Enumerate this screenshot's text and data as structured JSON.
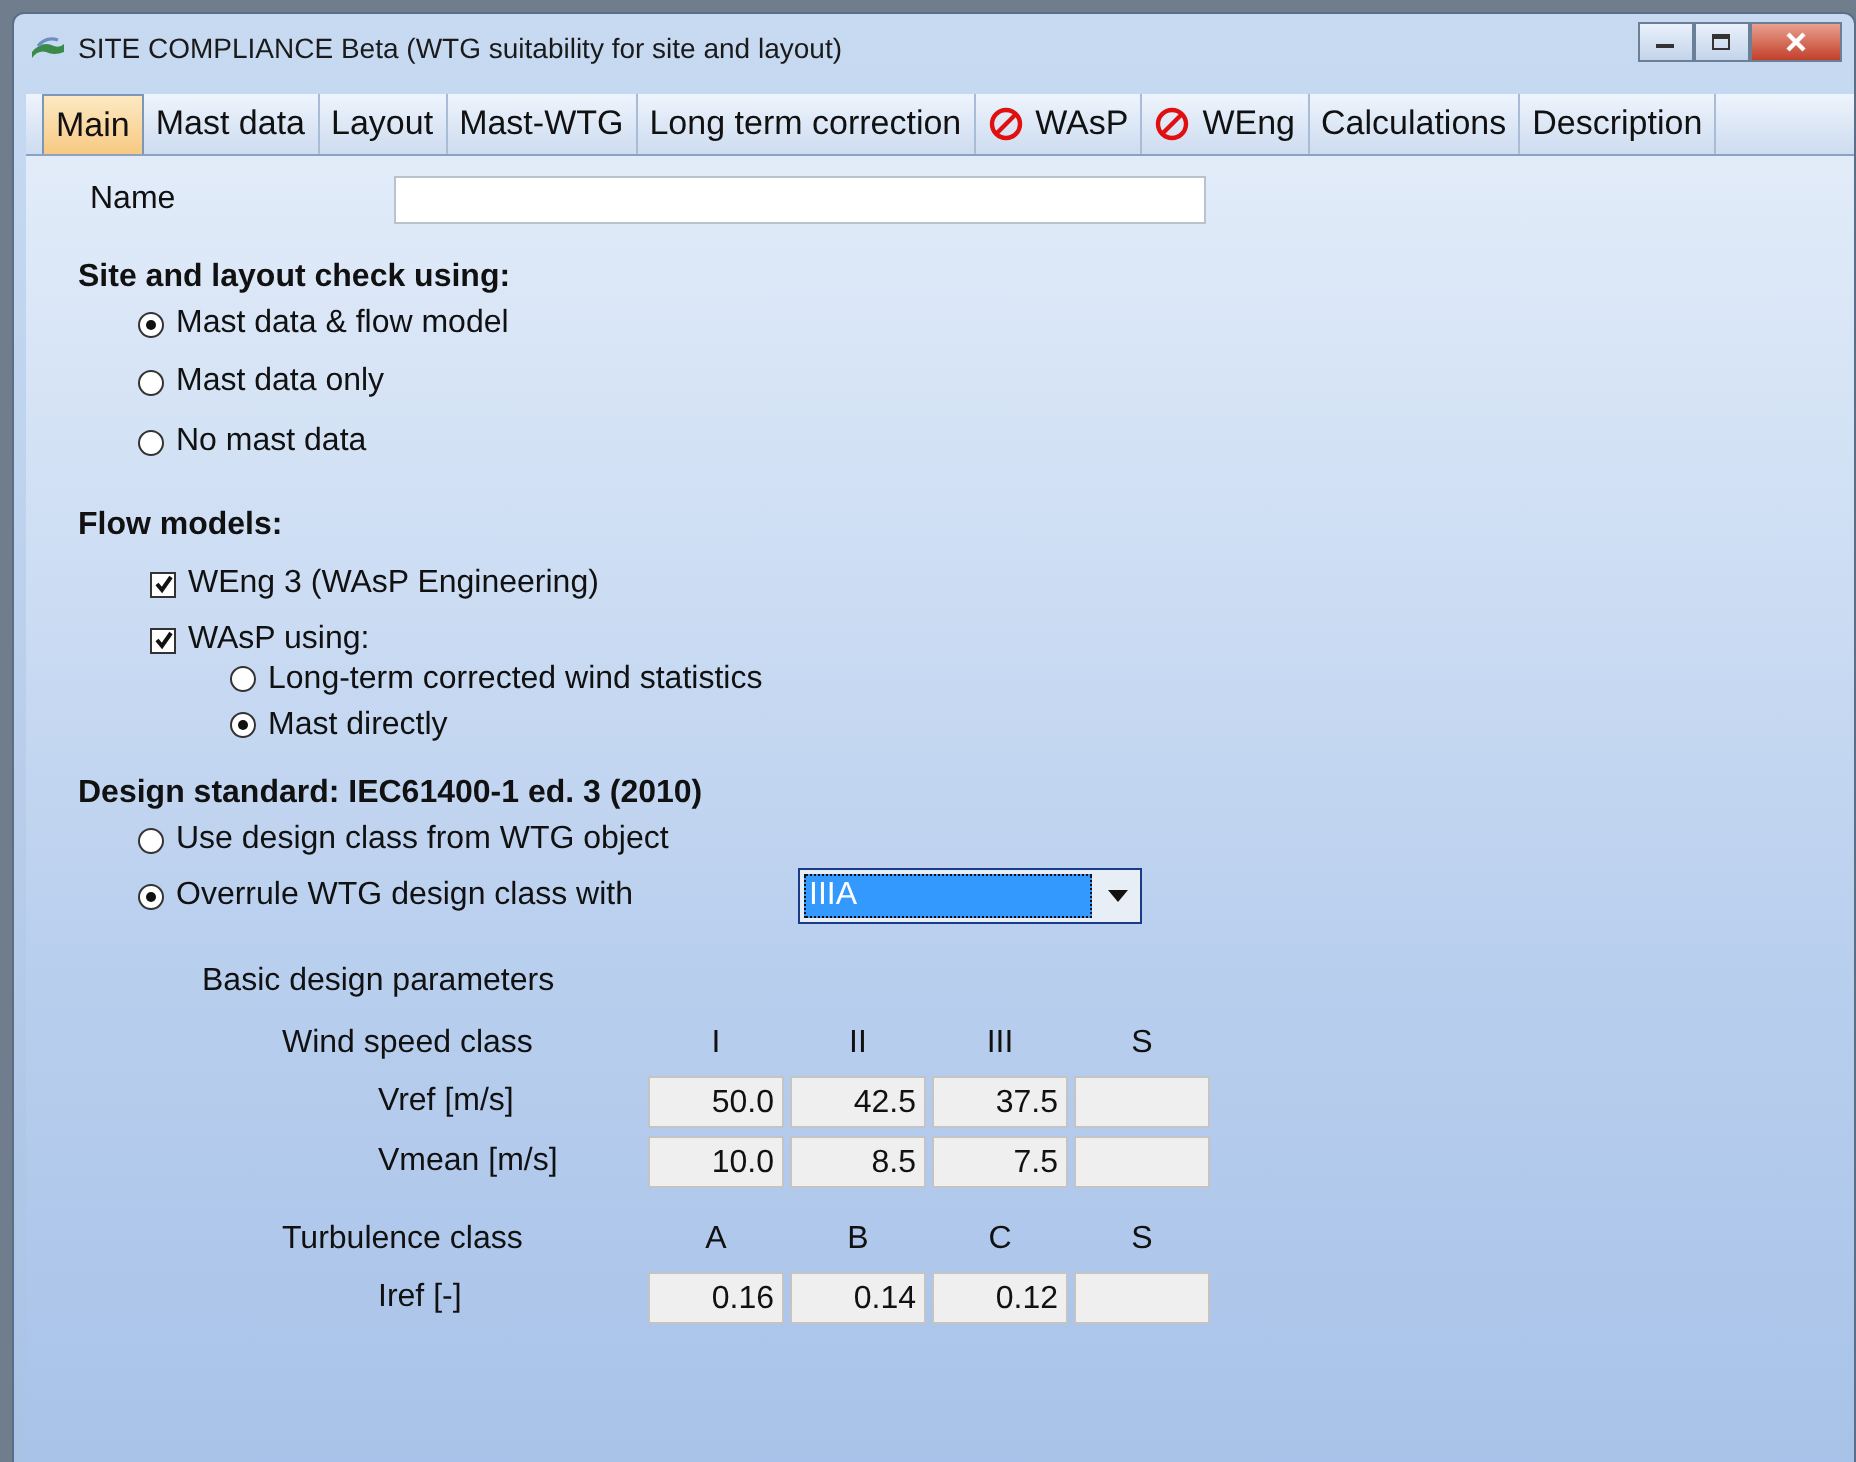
{
  "window": {
    "title": "SITE COMPLIANCE Beta (WTG suitability for site and layout)"
  },
  "tabs": [
    {
      "label": "Main",
      "selected": true,
      "blocked": false
    },
    {
      "label": "Mast data",
      "selected": false,
      "blocked": false
    },
    {
      "label": "Layout",
      "selected": false,
      "blocked": false
    },
    {
      "label": "Mast-WTG",
      "selected": false,
      "blocked": false
    },
    {
      "label": "Long term correction",
      "selected": false,
      "blocked": false
    },
    {
      "label": "WAsP",
      "selected": false,
      "blocked": true
    },
    {
      "label": "WEng",
      "selected": false,
      "blocked": true
    },
    {
      "label": "Calculations",
      "selected": false,
      "blocked": false
    },
    {
      "label": "Description",
      "selected": false,
      "blocked": false
    }
  ],
  "name_field": {
    "label": "Name"
  },
  "site_check": {
    "heading": "Site and layout check using:",
    "options": [
      {
        "label": "Mast data & flow model",
        "selected": true
      },
      {
        "label": "Mast data only",
        "selected": false
      },
      {
        "label": "No mast data",
        "selected": false
      }
    ]
  },
  "flow_models": {
    "heading": "Flow models:",
    "items": [
      {
        "label": "WEng 3 (WAsP Engineering)",
        "checked": true
      },
      {
        "label": "WAsP using:",
        "checked": true,
        "options": [
          {
            "label": "Long-term corrected wind statistics",
            "selected": false
          },
          {
            "label": "Mast directly",
            "selected": true
          }
        ]
      }
    ]
  },
  "design_standard": {
    "heading": "Design standard: IEC61400-1 ed. 3 (2010)",
    "options": [
      {
        "label": "Use design class from WTG object",
        "selected": false
      },
      {
        "label": "Overrule WTG design class with",
        "selected": true
      }
    ],
    "dropdown_value": "IIIA",
    "parameters_title": "Basic design parameters",
    "wind_header": [
      "Wind speed class",
      "I",
      "II",
      "III",
      "S"
    ],
    "wind_rows": [
      {
        "label": "Vref [m/s]",
        "values": [
          "50.0",
          "42.5",
          "37.5"
        ]
      },
      {
        "label": "Vmean [m/s]",
        "values": [
          "10.0",
          "8.5",
          "7.5"
        ]
      }
    ],
    "turb_header": [
      "Turbulence class",
      "A",
      "B",
      "C",
      "S"
    ],
    "turb_rows": [
      {
        "label": "Iref [-]",
        "values": [
          "0.16",
          "0.14",
          "0.12"
        ]
      }
    ]
  }
}
